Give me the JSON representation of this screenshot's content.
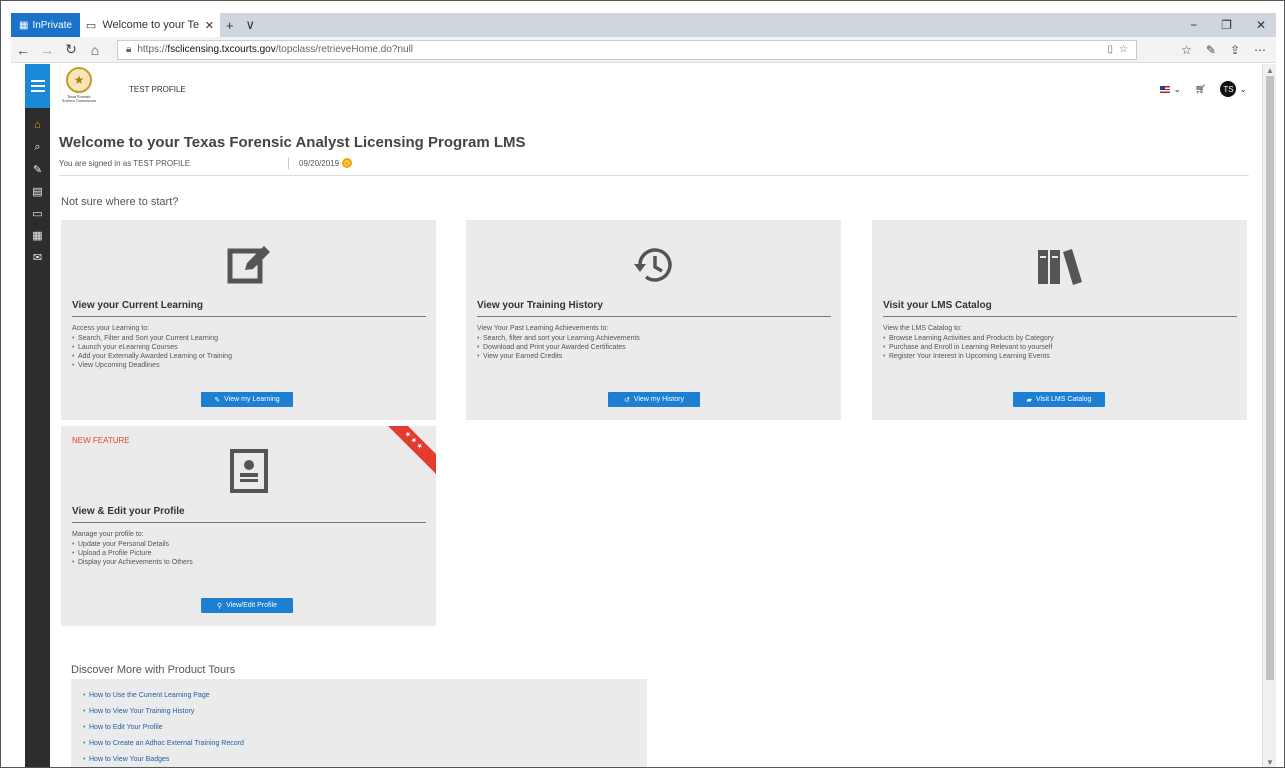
{
  "browser": {
    "inprivate_label": "InPrivate",
    "tab_title": "Welcome to your Texas",
    "tab_close": "✕",
    "new_tab": "+",
    "tab_menu": "∨",
    "url_prefix": "https://",
    "url_domain": "fsclicensing.txcourts.gov",
    "url_path": "/topclass/retrieveHome.do?null",
    "win_min": "−",
    "win_max": "❐",
    "win_close": "✕"
  },
  "header": {
    "profile_name": "TEST PROFILE",
    "avatar_initials": "TS",
    "logo_text_1": "Texas Forensic",
    "logo_text_2": "Science Commission"
  },
  "welcome": {
    "title": "Welcome to your Texas Forensic Analyst Licensing Program LMS",
    "signed_in": "You are signed in as TEST PROFILE",
    "date": "09/20/2019"
  },
  "start_heading": "Not sure where to start?",
  "cards": {
    "learning": {
      "title": "View your Current Learning",
      "intro": "Access your Learning to:",
      "items": [
        "Search, Filter and Sort your Current Learning",
        "Launch your eLearning Courses",
        "Add your Externally Awarded Learning or Training",
        "View Upcoming Deadlines"
      ],
      "button": "View my Learning"
    },
    "history": {
      "title": "View your Training History",
      "intro": "View Your Past Learning Achievements to:",
      "items": [
        "Search, filter and sort your Learning Achievements",
        "Download and Print your Awarded Certificates",
        "View your Earned Credits"
      ],
      "button": "View my History"
    },
    "catalog": {
      "title": "Visit your LMS Catalog",
      "intro": "View the LMS Catalog to:",
      "items": [
        "Browse Learning Activities and Products by Category",
        "Purchase and Enroll in Learning Relevant to yourself",
        "Register Your Interest in Upcoming Learning Events"
      ],
      "button": "Visit LMS Catalog"
    },
    "profile": {
      "badge": "NEW FEATURE",
      "ribbon": "★ ★ ★",
      "title": "View & Edit your Profile",
      "intro": "Manage your profile to:",
      "items": [
        "Update your Personal Details",
        "Upload a Profile Picture",
        "Display your Achievements to Others"
      ],
      "button": "View/Edit Profile"
    }
  },
  "tours": {
    "heading": "Discover More with Product Tours",
    "links": [
      "How to Use the Current Learning Page",
      "How to View Your Training History",
      "How to Edit Your Profile",
      "How to Create an Adhoc External Training Record",
      "How to View Your Badges"
    ]
  }
}
